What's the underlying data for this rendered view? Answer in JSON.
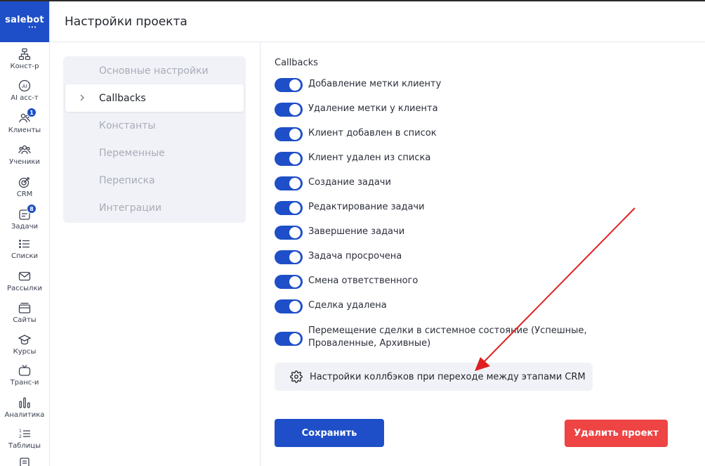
{
  "brand": {
    "name": "salebot",
    "dots": "•••",
    "color": "#1e4fc8"
  },
  "header": {
    "title": "Настройки проекта"
  },
  "rail": [
    {
      "label": "Конст-р",
      "icon": "hierarchy-icon"
    },
    {
      "label": "AI асс-т",
      "icon": "ai-icon"
    },
    {
      "label": "Клиенты",
      "icon": "users-icon",
      "badge": "1"
    },
    {
      "label": "Ученики",
      "icon": "students-icon"
    },
    {
      "label": "CRM",
      "icon": "target-icon"
    },
    {
      "label": "Задачи",
      "icon": "tasks-icon",
      "badge": "8"
    },
    {
      "label": "Списки",
      "icon": "list-icon"
    },
    {
      "label": "Рассылки",
      "icon": "mail-icon"
    },
    {
      "label": "Сайты",
      "icon": "sites-icon"
    },
    {
      "label": "Курсы",
      "icon": "graduation-cap-icon"
    },
    {
      "label": "Транс-и",
      "icon": "tv-icon"
    },
    {
      "label": "Аналитика",
      "icon": "analytics-icon"
    },
    {
      "label": "Таблицы",
      "icon": "numbered-list-icon"
    }
  ],
  "nav": {
    "items": [
      {
        "label": "Основные настройки"
      },
      {
        "label": "Callbacks",
        "active": true
      },
      {
        "label": "Константы"
      },
      {
        "label": "Переменные"
      },
      {
        "label": "Переписка"
      },
      {
        "label": "Интеграции"
      }
    ]
  },
  "callbacks": {
    "title": "Callbacks",
    "items": [
      {
        "label": "Добавление метки клиенту",
        "on": true
      },
      {
        "label": "Удаление метки у клиента",
        "on": true
      },
      {
        "label": "Клиент добавлен в список",
        "on": true
      },
      {
        "label": "Клиент удален из списка",
        "on": true
      },
      {
        "label": "Создание задачи",
        "on": true
      },
      {
        "label": "Редактирование задачи",
        "on": true
      },
      {
        "label": "Завершение задачи",
        "on": true
      },
      {
        "label": "Задача просрочена",
        "on": true
      },
      {
        "label": "Смена ответственного",
        "on": true
      },
      {
        "label": "Сделка удалена",
        "on": true
      },
      {
        "label": "Перемещение сделки в системное состояние (Успешные, Проваленные, Архивные)",
        "on": true
      }
    ],
    "crm_button": "Настройки коллбэков при переходе между этапами CRM"
  },
  "actions": {
    "save": "Сохранить",
    "delete": "Удалить проект"
  },
  "colors": {
    "accent": "#1e4fc8",
    "danger": "#ee4444",
    "annotation": "#e02020"
  }
}
